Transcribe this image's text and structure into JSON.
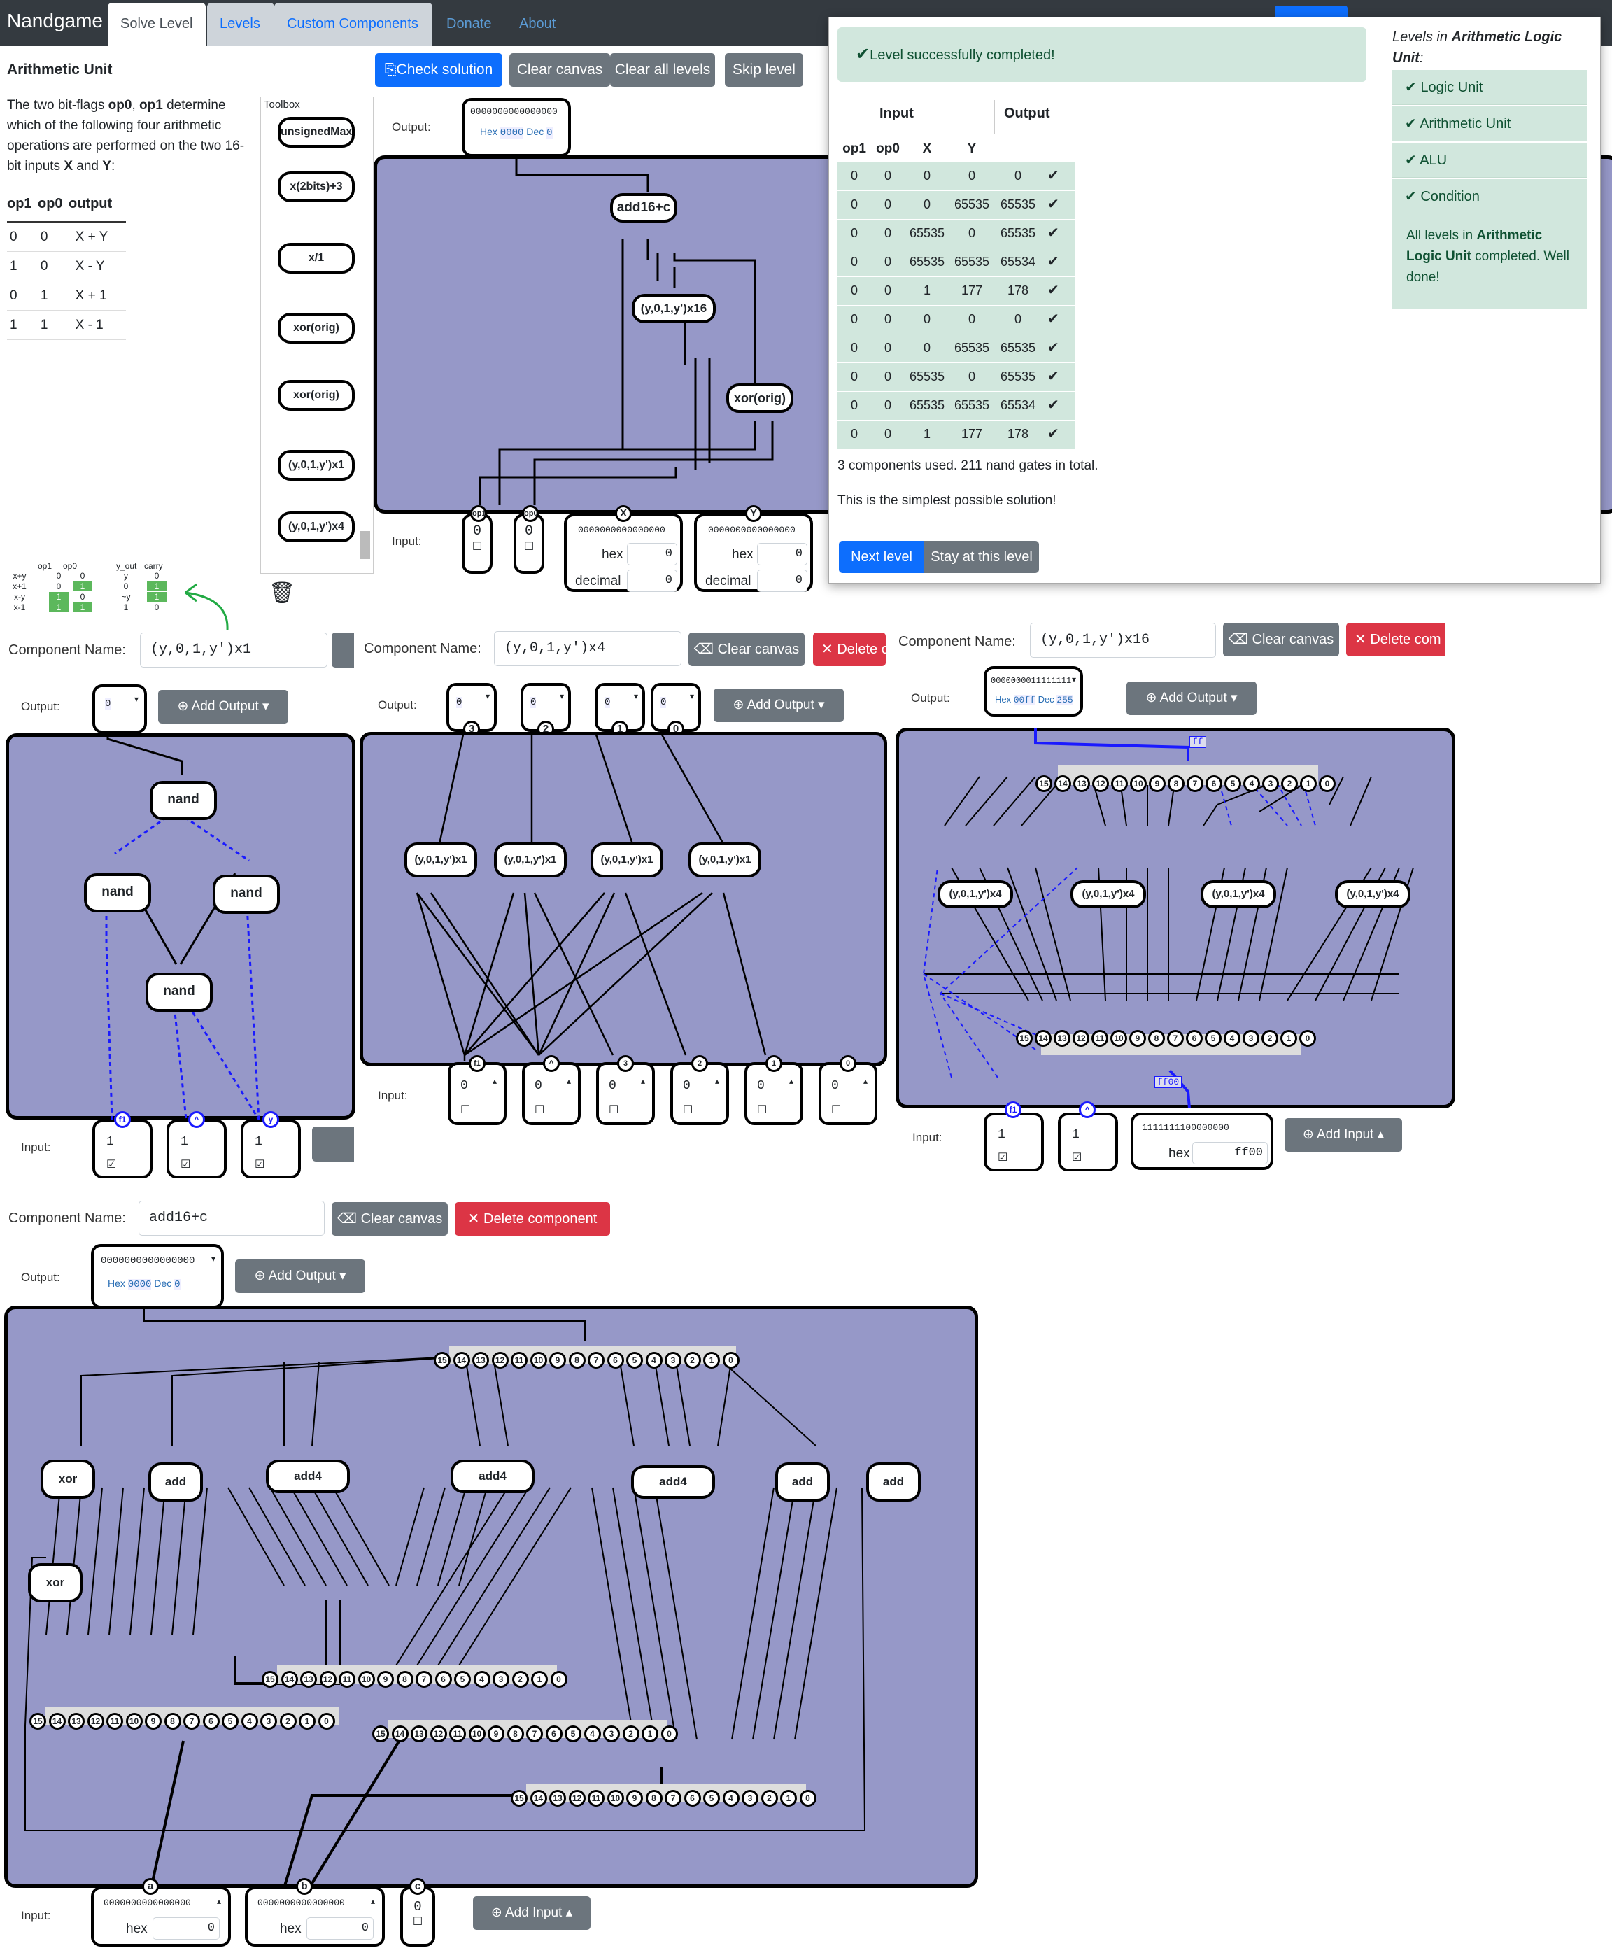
{
  "nav": {
    "brand": "Nandgame",
    "tabs": [
      "Solve Level",
      "Levels",
      "Custom Components",
      "Donate",
      "About"
    ]
  },
  "level": {
    "title": "Arithmetic Unit",
    "desc_pre": "The two bit-flags ",
    "desc_b1": "op0",
    "desc_mid1": ", ",
    "desc_b2": "op1",
    "desc_mid2": " determine which of the following four arithmetic operations are performed on the two 16-bit inputs ",
    "desc_b3": "X",
    "desc_mid3": " and ",
    "desc_b4": "Y",
    "desc_end": ":",
    "table_headers": [
      "op1",
      "op0",
      "output"
    ],
    "table_rows": [
      [
        "0",
        "0",
        "X + Y"
      ],
      [
        "1",
        "0",
        "X - Y"
      ],
      [
        "0",
        "1",
        "X + 1"
      ],
      [
        "1",
        "1",
        "X - 1"
      ]
    ],
    "mini_headers": [
      "op1",
      "op0",
      "y_out",
      "carry"
    ],
    "mini_rows": [
      [
        "x+y",
        "0",
        "0",
        "y",
        "0"
      ],
      [
        "x+1",
        "0",
        "1",
        "0",
        "1"
      ],
      [
        "x-y",
        "1",
        "0",
        "~y",
        "1"
      ],
      [
        "x-1",
        "1",
        "1",
        "1",
        "0"
      ]
    ]
  },
  "toolbar": {
    "check": "Check solution",
    "clear_canvas": "Clear canvas",
    "clear_all": "Clear all levels",
    "skip": "Skip level"
  },
  "toolbox": {
    "title": "Toolbox",
    "items": [
      "unsignedMax",
      "x(2bits)+3",
      "x/1",
      "xor(orig)",
      "xor(orig)",
      "(y,0,1,y')x1",
      "(y,0,1,y')x4"
    ]
  },
  "main_canvas": {
    "output_label": "Output:",
    "input_label": "Input:",
    "output_bits": "0000000000000000",
    "output_hex": "0000",
    "output_dec": "0",
    "hex_word": "Hex",
    "dec_word": "Dec",
    "components": [
      "add16+c",
      "(y,0,1,y')x16",
      "xor(orig)"
    ],
    "input_pins": [
      "op1",
      "op0",
      "X",
      "Y"
    ],
    "op1_value": "0",
    "op0_value": "0",
    "x_bits": "0000000000000000",
    "y_bits": "0000000000000000",
    "hex_label": "hex",
    "dec_label": "decimal",
    "x_hex": "0",
    "x_dec": "0",
    "y_hex": "0",
    "y_dec": "0"
  },
  "result": {
    "success": "Level successfully completed!",
    "input_header": "Input",
    "output_header": "Output",
    "col_headers": [
      "op1",
      "op0",
      "X",
      "Y",
      ""
    ],
    "rows": [
      [
        "0",
        "0",
        "0",
        "0",
        "0"
      ],
      [
        "0",
        "0",
        "0",
        "65535",
        "65535"
      ],
      [
        "0",
        "0",
        "65535",
        "0",
        "65535"
      ],
      [
        "0",
        "0",
        "65535",
        "65535",
        "65534"
      ],
      [
        "0",
        "0",
        "1",
        "177",
        "178"
      ],
      [
        "0",
        "0",
        "0",
        "0",
        "0"
      ],
      [
        "0",
        "0",
        "0",
        "65535",
        "65535"
      ],
      [
        "0",
        "0",
        "65535",
        "0",
        "65535"
      ],
      [
        "0",
        "0",
        "65535",
        "65535",
        "65534"
      ],
      [
        "0",
        "0",
        "1",
        "177",
        "178"
      ]
    ],
    "stats": "3 components used. 211 nand gates in total.",
    "simplest": "This is the simplest possible solution!",
    "next": "Next level",
    "stay": "Stay at this level"
  },
  "levels_panel": {
    "intro_pre": "Levels in ",
    "intro_b": "Arithmetic Logic Unit",
    "intro_post": ":",
    "items": [
      "Logic Unit",
      "Arithmetic Unit",
      "ALU",
      "Condition"
    ],
    "done_pre": "All levels in ",
    "done_b": "Arithmetic Logic Unit",
    "done_post": " completed. Well done!"
  },
  "comp1": {
    "name_label": "Component Name:",
    "name": "(y,0,1,y')x1",
    "output_label": "Output:",
    "add_output": "Add Output",
    "gates": [
      "nand",
      "nand",
      "nand",
      "nand"
    ],
    "inputs": [
      "f1",
      "^",
      "y"
    ],
    "input_values": [
      "1",
      "1",
      "1"
    ],
    "input_label": "Input:",
    "out_value": "0"
  },
  "comp2": {
    "name_label": "Component Name:",
    "name": "(y,0,1,y')x4",
    "clear": "Clear canvas",
    "delete": "Delete c",
    "output_label": "Output:",
    "add_output": "Add Output",
    "outputs": [
      "3",
      "2",
      "1",
      "0"
    ],
    "gates": [
      "(y,0,1,y')x1",
      "(y,0,1,y')x1",
      "(y,0,1,y')x1",
      "(y,0,1,y')x1"
    ],
    "inputs": [
      "f1",
      "^",
      "3",
      "2",
      "1",
      "0"
    ],
    "input_values": [
      "0",
      "0",
      "0",
      "0",
      "0",
      "0"
    ],
    "input_label": "Input:"
  },
  "comp3": {
    "name_label": "Component Name:",
    "name": "(y,0,1,y')x16",
    "clear": "Clear canvas",
    "delete": "Delete com",
    "output_label": "Output:",
    "add_output": "Add Output",
    "out_bits": "0000000011111111",
    "out_hex": "00ff",
    "out_dec": "255",
    "gates": [
      "(y,0,1,y')x4",
      "(y,0,1,y')x4",
      "(y,0,1,y')x4",
      "(y,0,1,y')x4"
    ],
    "bus_label": "ff",
    "bus_label2": "ff00",
    "inputs": [
      "f1",
      "^"
    ],
    "input_values": [
      "1",
      "1"
    ],
    "in_bits": "1111111100000000",
    "in_hex": "ff00",
    "hex_label": "hex",
    "add_input": "Add Input",
    "input_label": "Input:"
  },
  "comp4": {
    "name_label": "Component Name:",
    "name": "add16+c",
    "clear": "Clear canvas",
    "delete": "Delete component",
    "output_label": "Output:",
    "add_output": "Add Output",
    "out_bits": "0000000000000000",
    "out_hex": "0000",
    "out_dec": "0",
    "gates": [
      "xor",
      "xor",
      "add",
      "add4",
      "add4",
      "add4",
      "add",
      "add"
    ],
    "inputs": [
      "a",
      "b",
      "c"
    ],
    "a_bits": "0000000000000000",
    "b_bits": "0000000000000000",
    "a_hex": "0",
    "b_hex": "0",
    "c_value": "0",
    "hex_label": "hex",
    "add_input": "Add Input",
    "input_label": "Input:"
  },
  "bit_labels": [
    "15",
    "14",
    "13",
    "12",
    "11",
    "10",
    "9",
    "8",
    "7",
    "6",
    "5",
    "4",
    "3",
    "2",
    "1",
    "0"
  ],
  "colors": {
    "canvas": "#9698c8",
    "primary": "#0d6efd",
    "success_bg": "#d1e7dd",
    "navbar": "#343a40",
    "danger": "#dc3545"
  }
}
